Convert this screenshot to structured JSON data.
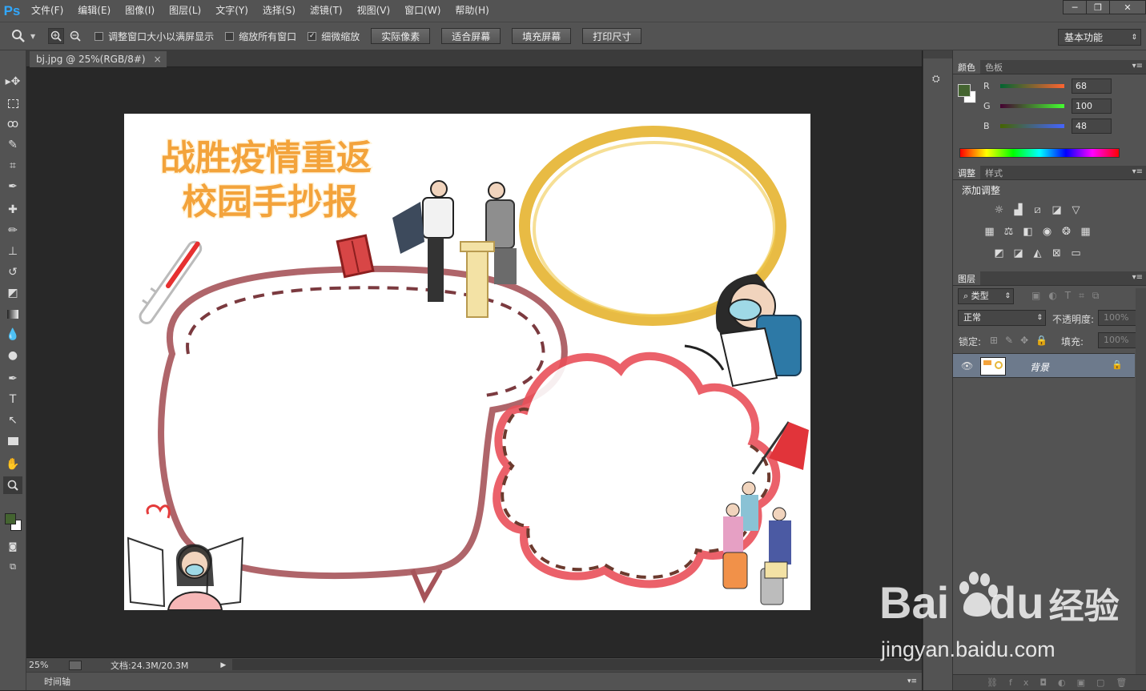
{
  "app": {
    "logo": "Ps"
  },
  "menu": [
    "文件(F)",
    "编辑(E)",
    "图像(I)",
    "图层(L)",
    "文字(Y)",
    "选择(S)",
    "滤镜(T)",
    "视图(V)",
    "窗口(W)",
    "帮助(H)"
  ],
  "window_controls": {
    "minimize": "─",
    "restore": "❐",
    "close": "✕"
  },
  "options": {
    "fit_window_resize": {
      "label": "调整窗口大小以满屏显示",
      "checked": false
    },
    "zoom_all_windows": {
      "label": "缩放所有窗口",
      "checked": false
    },
    "scrubby_zoom": {
      "label": "细微缩放",
      "checked": true
    },
    "buttons": [
      "实际像素",
      "适合屏幕",
      "填充屏幕",
      "打印尺寸"
    ],
    "workspace": "基本功能"
  },
  "document": {
    "tab_title": "bj.jpg @ 25%(RGB/8#)",
    "close": "×"
  },
  "artwork": {
    "title_line1": "战胜疫情重返",
    "title_line2": "校园手抄报"
  },
  "status": {
    "zoom": "25%",
    "doc_size": "文档:24.3M/20.3M"
  },
  "timeline": {
    "label": "时间轴"
  },
  "color_panel": {
    "tabs": [
      "颜色",
      "色板"
    ],
    "r": {
      "label": "R",
      "value": "68"
    },
    "g": {
      "label": "G",
      "value": "100"
    },
    "b": {
      "label": "B",
      "value": "48"
    },
    "foreground": "#446430",
    "background": "#ffffff"
  },
  "adjust_panel": {
    "tabs": [
      "调整",
      "样式"
    ],
    "title": "添加调整"
  },
  "layers_panel": {
    "tab": "图层",
    "filter": "类型",
    "blend_mode": "正常",
    "opacity_label": "不透明度:",
    "opacity_value": "100%",
    "lock_label": "锁定:",
    "fill_label": "填充:",
    "fill_value": "100%",
    "layer_name": "背景"
  },
  "watermark": {
    "brand": "Bai",
    "brand2": "du",
    "brand_cn": "经验",
    "url": "jingyan.baidu.com"
  }
}
